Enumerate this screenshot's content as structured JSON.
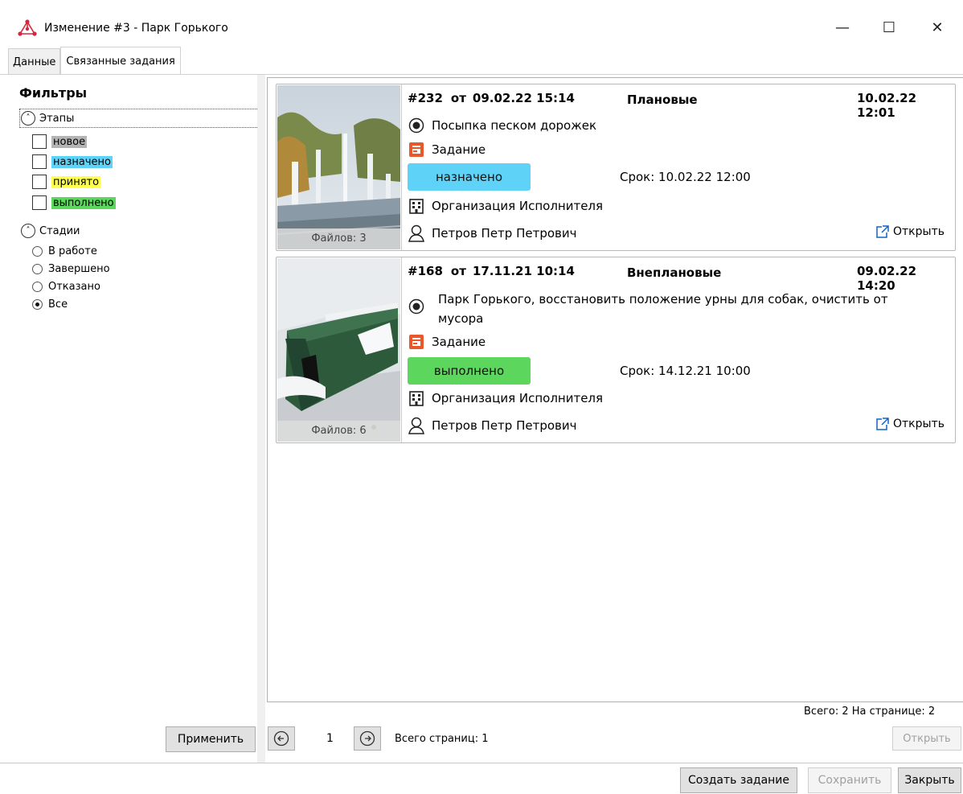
{
  "window": {
    "title": "Изменение #3 - Парк Горького",
    "min_glyph": "—",
    "max_glyph": "☐",
    "close_glyph": "✕"
  },
  "tabs": [
    {
      "label": "Данные",
      "active": false
    },
    {
      "label": "Связанные задания",
      "active": true
    }
  ],
  "filters": {
    "title": "Фильтры",
    "stages_label": "Этапы",
    "stages": [
      {
        "label": "новое",
        "color": "#b4b4b4",
        "checked": false
      },
      {
        "label": "назначено",
        "color": "#5ed3f7",
        "checked": false
      },
      {
        "label": "принято",
        "color": "#ffff4d",
        "checked": false
      },
      {
        "label": "выполнено",
        "color": "#5cd65c",
        "checked": false
      }
    ],
    "phases_label": "Стадии",
    "phases": [
      {
        "label": "В работе",
        "checked": false
      },
      {
        "label": "Завершено",
        "checked": false
      },
      {
        "label": "Отказано",
        "checked": false
      },
      {
        "label": "Все",
        "checked": true
      }
    ],
    "apply_label": "Применить"
  },
  "cards": [
    {
      "number": "#232",
      "from_label": "от",
      "created": "09.02.22 15:14",
      "type": "Плановые",
      "date": "10.02.22 12:01",
      "title": "Посыпка песком дорожек",
      "kind": "Задание",
      "status": "назначено",
      "status_color": "#5ed3f7",
      "deadline": "Срок: 10.02.22 12:00",
      "organization": "Организация Исполнителя",
      "person": "Петров Петр Петрович",
      "open_label": "Открыть",
      "files": "Файлов: 3"
    },
    {
      "number": "#168",
      "from_label": "от",
      "created": "17.11.21 10:14",
      "type": "Внеплановые",
      "date": "09.02.22 14:20",
      "title_line1": "Парк Горького, восстановить положение урны для собак, очистить от",
      "title_line2": "мусора",
      "kind": "Задание",
      "status": "выполнено",
      "status_color": "#5cd65c",
      "deadline": "Срок: 14.12.21 10:00",
      "organization": "Организация Исполнителя",
      "person": "Петров Петр Петрович",
      "open_label": "Открыть",
      "files": "Файлов: 6"
    }
  ],
  "list_footer": {
    "totals": "Всего: 2  На странице: 2",
    "page": "1",
    "total_pages": "Всего страниц: 1",
    "open_label": "Открыть"
  },
  "bottom_buttons": {
    "create": "Создать задание",
    "save": "Сохранить",
    "close": "Закрыть"
  }
}
